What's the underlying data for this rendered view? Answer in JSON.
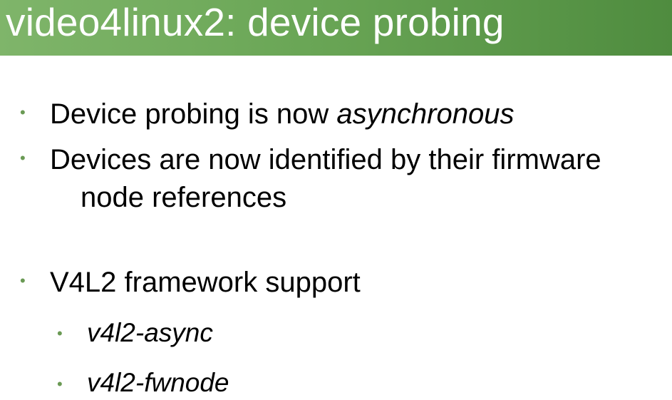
{
  "slide": {
    "title": "video4linux2: device probing",
    "bullets": [
      {
        "text_plain": "Device probing is now ",
        "text_italic": "asynchronous"
      },
      {
        "line1": "Devices are now identified by their firmware",
        "line2": "node references"
      },
      {
        "text": "V4L2 framework support"
      }
    ],
    "sub_bullets": [
      {
        "text": "v4l2-async"
      },
      {
        "text": "v4l2-fwnode"
      }
    ],
    "bullet_glyph": "•",
    "colors": {
      "title_gradient_start": "#7fb56a",
      "title_gradient_end": "#4f8c3f",
      "title_text": "#ffffff",
      "bullet": "#6a9a54",
      "body_text": "#000000"
    }
  }
}
